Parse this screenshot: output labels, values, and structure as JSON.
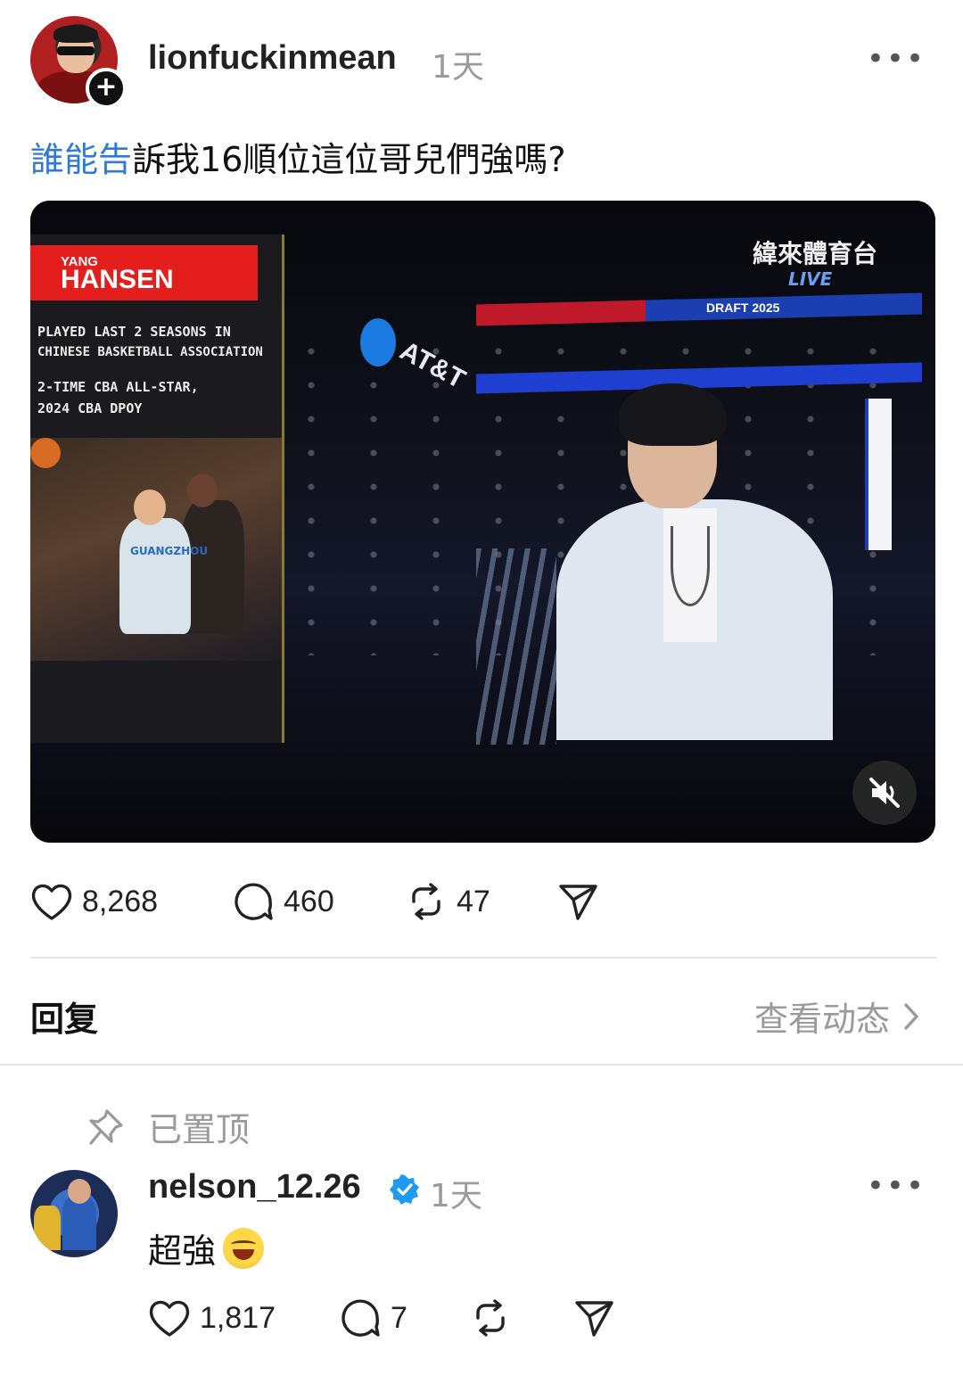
{
  "post": {
    "username": "lionfuckinmean",
    "time": "1天",
    "more_label": "•••",
    "follow_label": "+",
    "text_highlight": "誰能告",
    "text_rest": "訴我16順位這位哥兒們強嗎?",
    "media": {
      "overlay_first_name": "YANG",
      "overlay_last_name": "HANSEN",
      "overlay_line1": "PLAYED LAST 2 SEASONS IN",
      "overlay_line2": "CHINESE BASKETBALL ASSOCIATION",
      "overlay_line3": "2-TIME CBA ALL-STAR,",
      "overlay_line4": "2024 CBA DPOY",
      "channel_name": "緯來體育台",
      "channel_live": "LIVE",
      "arena_sponsor": "AT&T",
      "draft_banner": "DRAFT 2025",
      "jersey_text": "GUANGZHOU"
    },
    "likes": "8,268",
    "comments": "460",
    "reposts": "47"
  },
  "replies_header": {
    "title": "回复",
    "view_activity": "查看动态"
  },
  "pinned_label": "已置顶",
  "reply": {
    "username": "nelson_12.26",
    "time": "1天",
    "more_label": "•••",
    "text": "超強",
    "likes": "1,817",
    "comments": "7"
  },
  "icons": {
    "like": "heart-icon",
    "comment": "comment-bubble-icon",
    "repost": "repost-icon",
    "share": "share-send-icon",
    "mute": "speaker-muted-icon",
    "pin": "pin-icon",
    "verified": "verified-badge-icon",
    "chevron": "chevron-right-icon"
  },
  "colors": {
    "link_blue": "#2d7bd6",
    "verified_blue": "#1d9bf0",
    "muted_gray": "#9a9a9a",
    "overlay_red": "#e41d1d"
  }
}
